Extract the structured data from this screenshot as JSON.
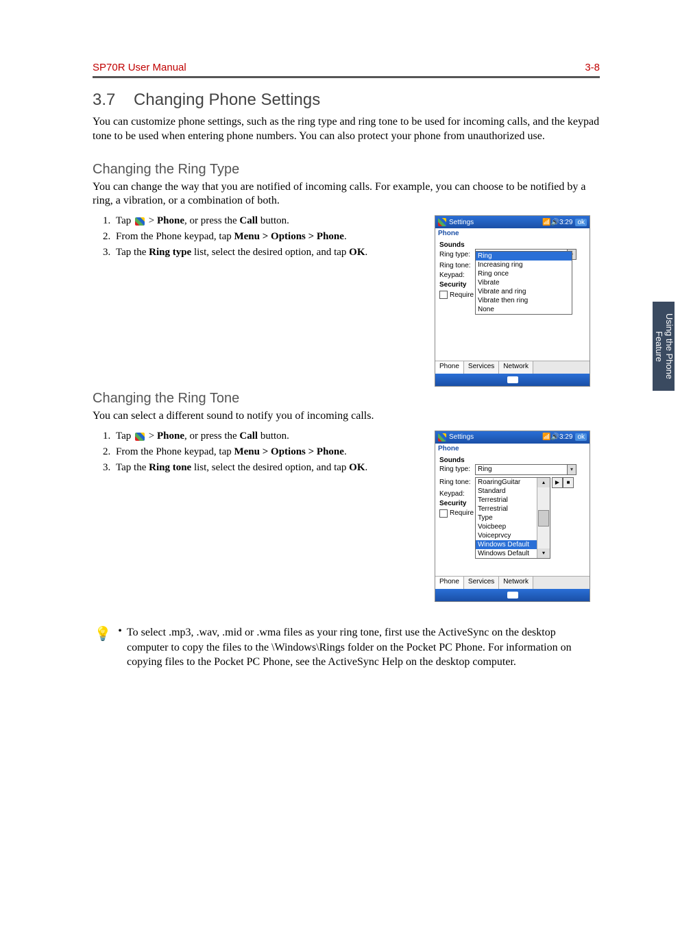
{
  "header": {
    "doc_title": "SP70R User Manual",
    "page_ref": "3-8"
  },
  "side_tab": "Using the Phone Feature",
  "section": {
    "number": "3.7",
    "title": "Changing Phone Settings",
    "intro": "You can customize phone settings, such as the ring type and ring tone to be used for incoming calls, and the keypad tone to be used when entering phone numbers. You can also protect your phone from unauthorized use."
  },
  "ring_type": {
    "title": "Changing the Ring Type",
    "intro": "You can change the way that you are notified of incoming calls. For example, you can choose to be notified by a ring, a vibration, or a combination of both.",
    "steps": {
      "s1a": "Tap ",
      "s1b": " > ",
      "s1_phone": "Phone",
      "s1c": ", or press the ",
      "s1_call": "Call",
      "s1d": " button.",
      "s2a": "From the Phone keypad, tap ",
      "s2_menu": "Menu > Options > Phone",
      "s2b": ".",
      "s3a": "Tap the ",
      "s3_ring": "Ring type",
      "s3b": " list, select the desired option, and tap ",
      "s3_ok": "OK",
      "s3c": "."
    },
    "screenshot": {
      "title": "Settings",
      "time": "3:29",
      "ok": "ok",
      "sub": "Phone",
      "sounds": "Sounds",
      "row_ringtype": "Ring type:",
      "val_ringtype": "Ring",
      "row_ringtone": "Ring tone:",
      "row_keypad": "Keypad:",
      "row_security": "Security",
      "row_require": "Require",
      "options": [
        "Ring",
        "Increasing ring",
        "Ring once",
        "Vibrate",
        "Vibrate and ring",
        "Vibrate then ring",
        "None"
      ],
      "tabs": [
        "Phone",
        "Services",
        "Network"
      ]
    }
  },
  "ring_tone": {
    "title": "Changing the Ring Tone",
    "intro": "You can select a different sound to notify you of incoming calls.",
    "steps": {
      "s1a": "Tap ",
      "s1b": " > ",
      "s1_phone": "Phone",
      "s1c": ", or press the ",
      "s1_call": "Call",
      "s1d": " button.",
      "s2a": "From the Phone keypad, tap ",
      "s2_menu": "Menu > Options > Phone",
      "s2b": ".",
      "s3a": "Tap the ",
      "s3_ring": "Ring tone",
      "s3b": " list, select the desired option, and tap ",
      "s3_ok": "OK",
      "s3c": "."
    },
    "screenshot": {
      "title": "Settings",
      "time": "3:29",
      "ok": "ok",
      "sub": "Phone",
      "sounds": "Sounds",
      "row_ringtype": "Ring type:",
      "val_ringtype": "Ring",
      "row_ringtone": "Ring tone:",
      "val_ringtone": "Windows Default",
      "row_keypad": "Keypad:",
      "row_security": "Security",
      "row_require": "Require",
      "options": [
        "RoaringGuitar",
        "Standard",
        "Terrestrial",
        "Terrestrial",
        "Type",
        "Voicbeep",
        "Voiceprvcy",
        "Windows Default",
        "Windows Default"
      ],
      "tabs": [
        "Phone",
        "Services",
        "Network"
      ]
    }
  },
  "tip": {
    "text": "To select .mp3, .wav, .mid or .wma files as your ring tone, first use the ActiveSync on the desktop computer to copy the files to the \\Windows\\Rings folder on the Pocket PC Phone. For information on copying files to the Pocket PC Phone, see the ActiveSync Help on the desktop computer."
  }
}
